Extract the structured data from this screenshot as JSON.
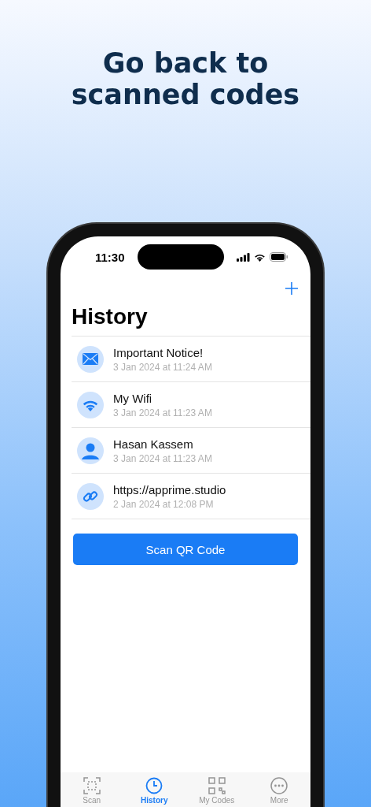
{
  "headline": "Go back to scanned codes",
  "status_bar": {
    "time": "11:30"
  },
  "screen": {
    "title": "History",
    "items": [
      {
        "kind": "email",
        "title": "Important Notice!",
        "date": "3 Jan 2024 at 11:24 AM"
      },
      {
        "kind": "wifi",
        "title": "My Wifi",
        "date": "3 Jan 2024 at 11:23 AM"
      },
      {
        "kind": "contact",
        "title": "Hasan Kassem",
        "date": "3 Jan 2024 at 11:23 AM"
      },
      {
        "kind": "url",
        "title": "https://apprime.studio",
        "date": "2 Jan 2024 at 12:08 PM"
      }
    ],
    "scan_button": "Scan QR Code"
  },
  "tab_bar": [
    {
      "kind": "scan",
      "label": "Scan",
      "selected": false
    },
    {
      "kind": "history",
      "label": "History",
      "selected": true
    },
    {
      "kind": "codes",
      "label": "My Codes",
      "selected": false
    },
    {
      "kind": "more",
      "label": "More",
      "selected": false
    }
  ]
}
